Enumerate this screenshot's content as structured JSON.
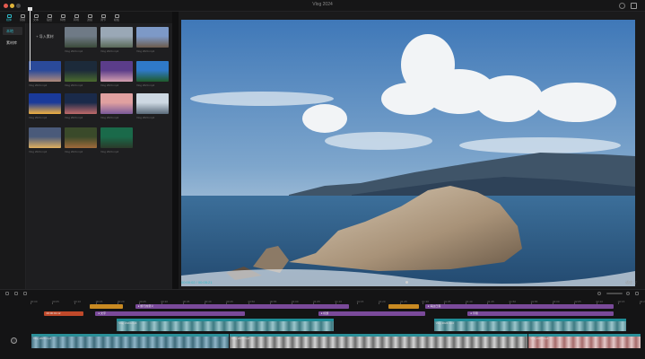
{
  "window": {
    "title": "Vlog 2024"
  },
  "toolbar": {
    "items": [
      {
        "label": "媒体",
        "icon": "media-icon",
        "active": true
      },
      {
        "label": "音频",
        "icon": "audio-icon",
        "active": false
      },
      {
        "label": "文本",
        "icon": "text-icon",
        "active": false
      },
      {
        "label": "贴纸",
        "icon": "sticker-icon",
        "active": false
      },
      {
        "label": "特效",
        "icon": "effects-icon",
        "active": false
      },
      {
        "label": "转场",
        "icon": "transition-icon",
        "active": false
      },
      {
        "label": "滤镜",
        "icon": "filter-icon",
        "active": false
      },
      {
        "label": "调节",
        "icon": "adjust-icon",
        "active": false
      },
      {
        "label": "模板",
        "icon": "template-icon",
        "active": false
      }
    ]
  },
  "left_nav": {
    "items": [
      {
        "label": "本地",
        "active": true
      },
      {
        "label": "素材库",
        "active": false
      }
    ]
  },
  "media": {
    "import_label": "+ 导入素材",
    "thumbs": [
      {
        "caption": "Vlog 2024.mp4",
        "c1": "#6f7a86",
        "c2": "#3b4a3a"
      },
      {
        "caption": "Vlog 2024.mp4",
        "c1": "#9aa8b6",
        "c2": "#5a6a58"
      },
      {
        "caption": "Vlog 2024.mp4",
        "c1": "#7d99c7",
        "c2": "#6c5b4c"
      },
      {
        "caption": "Vlog 2024.mp4",
        "c1": "#2a4a9a",
        "c2": "#b08a7a"
      },
      {
        "caption": "Vlog 2024.mp4",
        "c1": "#1c2a3a",
        "c2": "#4b6b2e"
      },
      {
        "caption": "Vlog 2024.mp4",
        "c1": "#5b3d8a",
        "c2": "#d4a0b0"
      },
      {
        "caption": "Vlog 2024.mp4",
        "c1": "#2f79c8",
        "c2": "#1f5a2a"
      },
      {
        "caption": "Vlog 2024.mp4",
        "c1": "#1a3a9a",
        "c2": "#f0b040"
      },
      {
        "caption": "Vlog 2024.mp4",
        "c1": "#1a2a4a",
        "c2": "#c06a6a"
      },
      {
        "caption": "Vlog 2024.mp4",
        "c1": "#e0a0a0",
        "c2": "#7a5a9a"
      },
      {
        "caption": "Vlog 2024.mp4",
        "c1": "#cdd8e2",
        "c2": "#5a6b7a"
      },
      {
        "caption": "Vlog 2024.mp4",
        "c1": "#4a5a7a",
        "c2": "#e0b060"
      },
      {
        "caption": "Vlog 2024.mp4",
        "c1": "#3a4a2a",
        "c2": "#a06a3a"
      },
      {
        "caption": "Vlog 2024.mp4",
        "c1": "#1a6a4a",
        "c2": "#2a3a2a"
      }
    ]
  },
  "preview": {
    "timecode": "00:00:02  / 00:05:21",
    "controls": "适应  ⛶"
  },
  "timeline": {
    "ticks": [
      "00:00",
      "00:05",
      "00:10",
      "00:15",
      "00:20",
      "00:25",
      "00:30",
      "00:35",
      "00:40",
      "00:45",
      "00:50",
      "00:55",
      "01:00",
      "01:05",
      "01:10",
      "01:15",
      "01:20",
      "01:25",
      "01:30",
      "01:35",
      "01:40",
      "01:45",
      "01:50",
      "01:55",
      "02:00",
      "02:05",
      "02:10",
      "02:15",
      "02:20"
    ],
    "text_clips": [
      {
        "label": "",
        "color": "#c98a22",
        "start": 0.095,
        "len": 0.055,
        "row": 0
      },
      {
        "label": "● 旅行的意义",
        "color": "#7a4a9a",
        "start": 0.17,
        "len": 0.35,
        "row": 0
      },
      {
        "label": "",
        "color": "#c98a22",
        "start": 0.585,
        "len": 0.05,
        "row": 0
      },
      {
        "label": "● 海边日落",
        "color": "#7a4a9a",
        "start": 0.645,
        "len": 0.31,
        "row": 0
      },
      {
        "label": "00:00:01:12",
        "color": "#c0492a",
        "start": 0.02,
        "len": 0.065,
        "row": 1
      },
      {
        "label": "● 文字",
        "color": "#7a4a9a",
        "start": 0.105,
        "len": 0.245,
        "row": 1
      },
      {
        "label": "● 标题",
        "color": "#7a4a9a",
        "start": 0.47,
        "len": 0.175,
        "row": 1
      },
      {
        "label": "● 字幕",
        "color": "#7a4a9a",
        "start": 0.715,
        "len": 0.24,
        "row": 1
      }
    ],
    "overlay_clips": [
      {
        "label": "Vlog 2024.mp4",
        "start": 0.14,
        "len": 0.355
      },
      {
        "label": "Vlog 2024.mp4",
        "start": 0.66,
        "len": 0.315
      }
    ],
    "main_clips": [
      {
        "label": "Vlog 2024.mp4",
        "start": 0.0,
        "len": 0.325,
        "c1": "#8fb6c8",
        "c2": "#3e6a7a"
      },
      {
        "label": "Vlog 2024.mp4",
        "start": 0.325,
        "len": 0.49,
        "c1": "#d5d5d5",
        "c2": "#6a6a6a"
      },
      {
        "label": "Vlog 2024.mp4",
        "start": 0.815,
        "len": 0.185,
        "c1": "#e4c9c9",
        "c2": "#a56a6a"
      }
    ]
  }
}
